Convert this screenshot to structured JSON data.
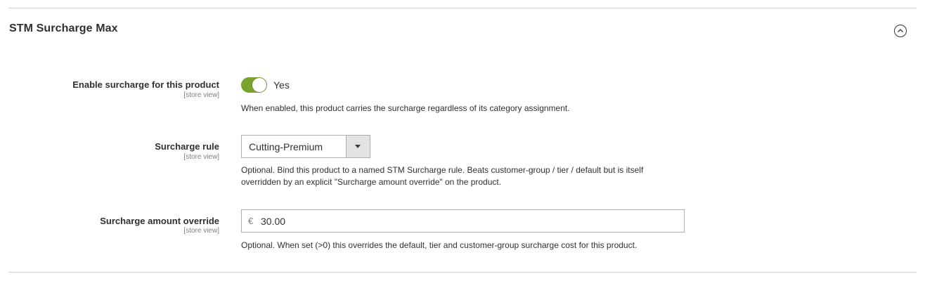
{
  "section": {
    "title": "STM Surcharge Max"
  },
  "fields": {
    "enable": {
      "label": "Enable surcharge for this product",
      "scope": "[store view]",
      "value": "Yes",
      "checked": true,
      "note": "When enabled, this product carries the surcharge regardless of its category assignment."
    },
    "rule": {
      "label": "Surcharge rule",
      "scope": "[store view]",
      "selected": "Cutting-Premium",
      "note_line1": "Optional. Bind this product to a named STM Surcharge rule. Beats customer-group / tier / default but is itself",
      "note_line2": "overridden by an explicit \"Surcharge amount override\" on the product."
    },
    "amount": {
      "label": "Surcharge amount override",
      "scope": "[store view]",
      "currency": "€",
      "value": "30.00",
      "note": "Optional. When set (>0) this overrides the default, tier and customer-group surcharge cost for this product."
    }
  },
  "colors": {
    "toggle_on": "#79a22e",
    "divider": "#d6d6d6"
  },
  "icons": {
    "collapse": "chevron-up-circle-icon",
    "dropdown": "caret-down-icon"
  }
}
